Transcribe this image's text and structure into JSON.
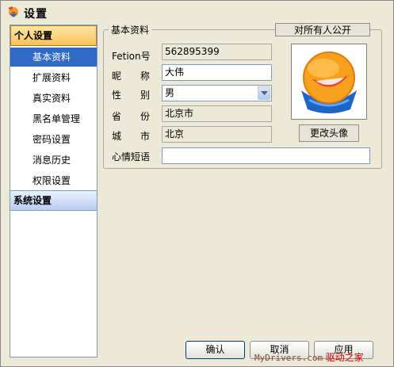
{
  "window": {
    "title": "设置"
  },
  "sidebar": {
    "personal_header": "个人设置",
    "items": [
      {
        "label": "基本资料"
      },
      {
        "label": "扩展资料"
      },
      {
        "label": "真实资料"
      },
      {
        "label": "黑名单管理"
      },
      {
        "label": "密码设置"
      },
      {
        "label": "消息历史"
      },
      {
        "label": "权限设置"
      }
    ],
    "system_header": "系统设置"
  },
  "profile": {
    "group_title": "基本资料",
    "privacy_button": "对所有人公开",
    "fetion_label": "Fetion号",
    "fetion_value": "562895399",
    "nickname_label": "昵　　称",
    "nickname_value": "大伟",
    "gender_label": "性　　别",
    "gender_value": "男",
    "province_label": "省　　份",
    "province_value": "北京市",
    "city_label": "城　　市",
    "city_value": "北京",
    "mood_label": "心情短语",
    "mood_value": "",
    "change_avatar_button": "更改头像"
  },
  "footer": {
    "ok": "确认",
    "cancel": "取消",
    "apply": "应用",
    "watermark_site": "MyDrivers.com",
    "watermark_name": "驱动之家"
  },
  "colors": {
    "selection": "#316ac5",
    "active_header": "#f8c25a",
    "watermark": "#cc0000"
  }
}
